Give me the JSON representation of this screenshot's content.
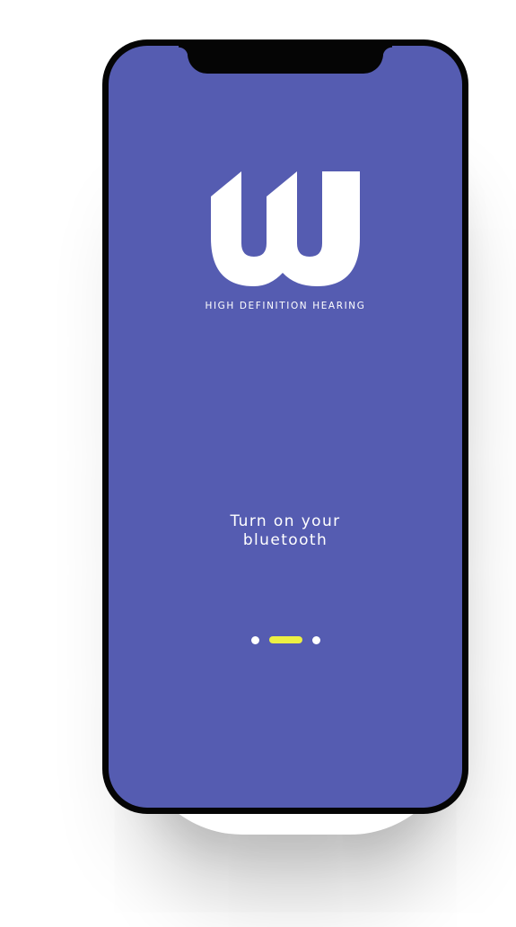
{
  "app": {
    "brand_tagline": "HIGH DEFINITION HEARING",
    "logo_icon": "w-brand-logo-icon"
  },
  "onboarding": {
    "message_line1": "Turn on your",
    "message_line2": "bluetooth",
    "pager": {
      "total_pages": 3,
      "current_page": 2
    }
  },
  "colors": {
    "screen_background": "#555cb1",
    "active_indicator": "#edf043",
    "inactive_indicator": "#ffffff",
    "text": "#ffffff",
    "phone_frame": "#050505"
  }
}
